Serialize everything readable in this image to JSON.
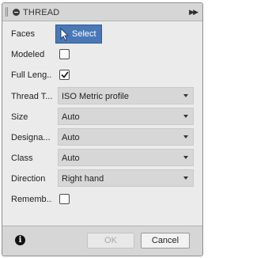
{
  "panel": {
    "title": "THREAD"
  },
  "rows": {
    "faces": {
      "label": "Faces",
      "button_label": "Select"
    },
    "modeled": {
      "label": "Modeled",
      "checked": false
    },
    "full_length": {
      "label": "Full Leng...",
      "checked": true
    },
    "thread_type": {
      "label": "Thread T...",
      "value": "ISO Metric profile"
    },
    "size": {
      "label": "Size",
      "value": "Auto"
    },
    "designation": {
      "label": "Designa...",
      "value": "Auto"
    },
    "class": {
      "label": "Class",
      "value": "Auto"
    },
    "direction": {
      "label": "Direction",
      "value": "Right hand"
    },
    "remember": {
      "label": "Rememb...",
      "checked": false
    }
  },
  "footer": {
    "info_icon": "info-icon",
    "ok_label": "OK",
    "cancel_label": "Cancel",
    "ok_enabled": false
  },
  "colors": {
    "select_button": "#4a78b7",
    "panel_bg": "#ebebeb",
    "header_bg": "#d6d6d6"
  }
}
